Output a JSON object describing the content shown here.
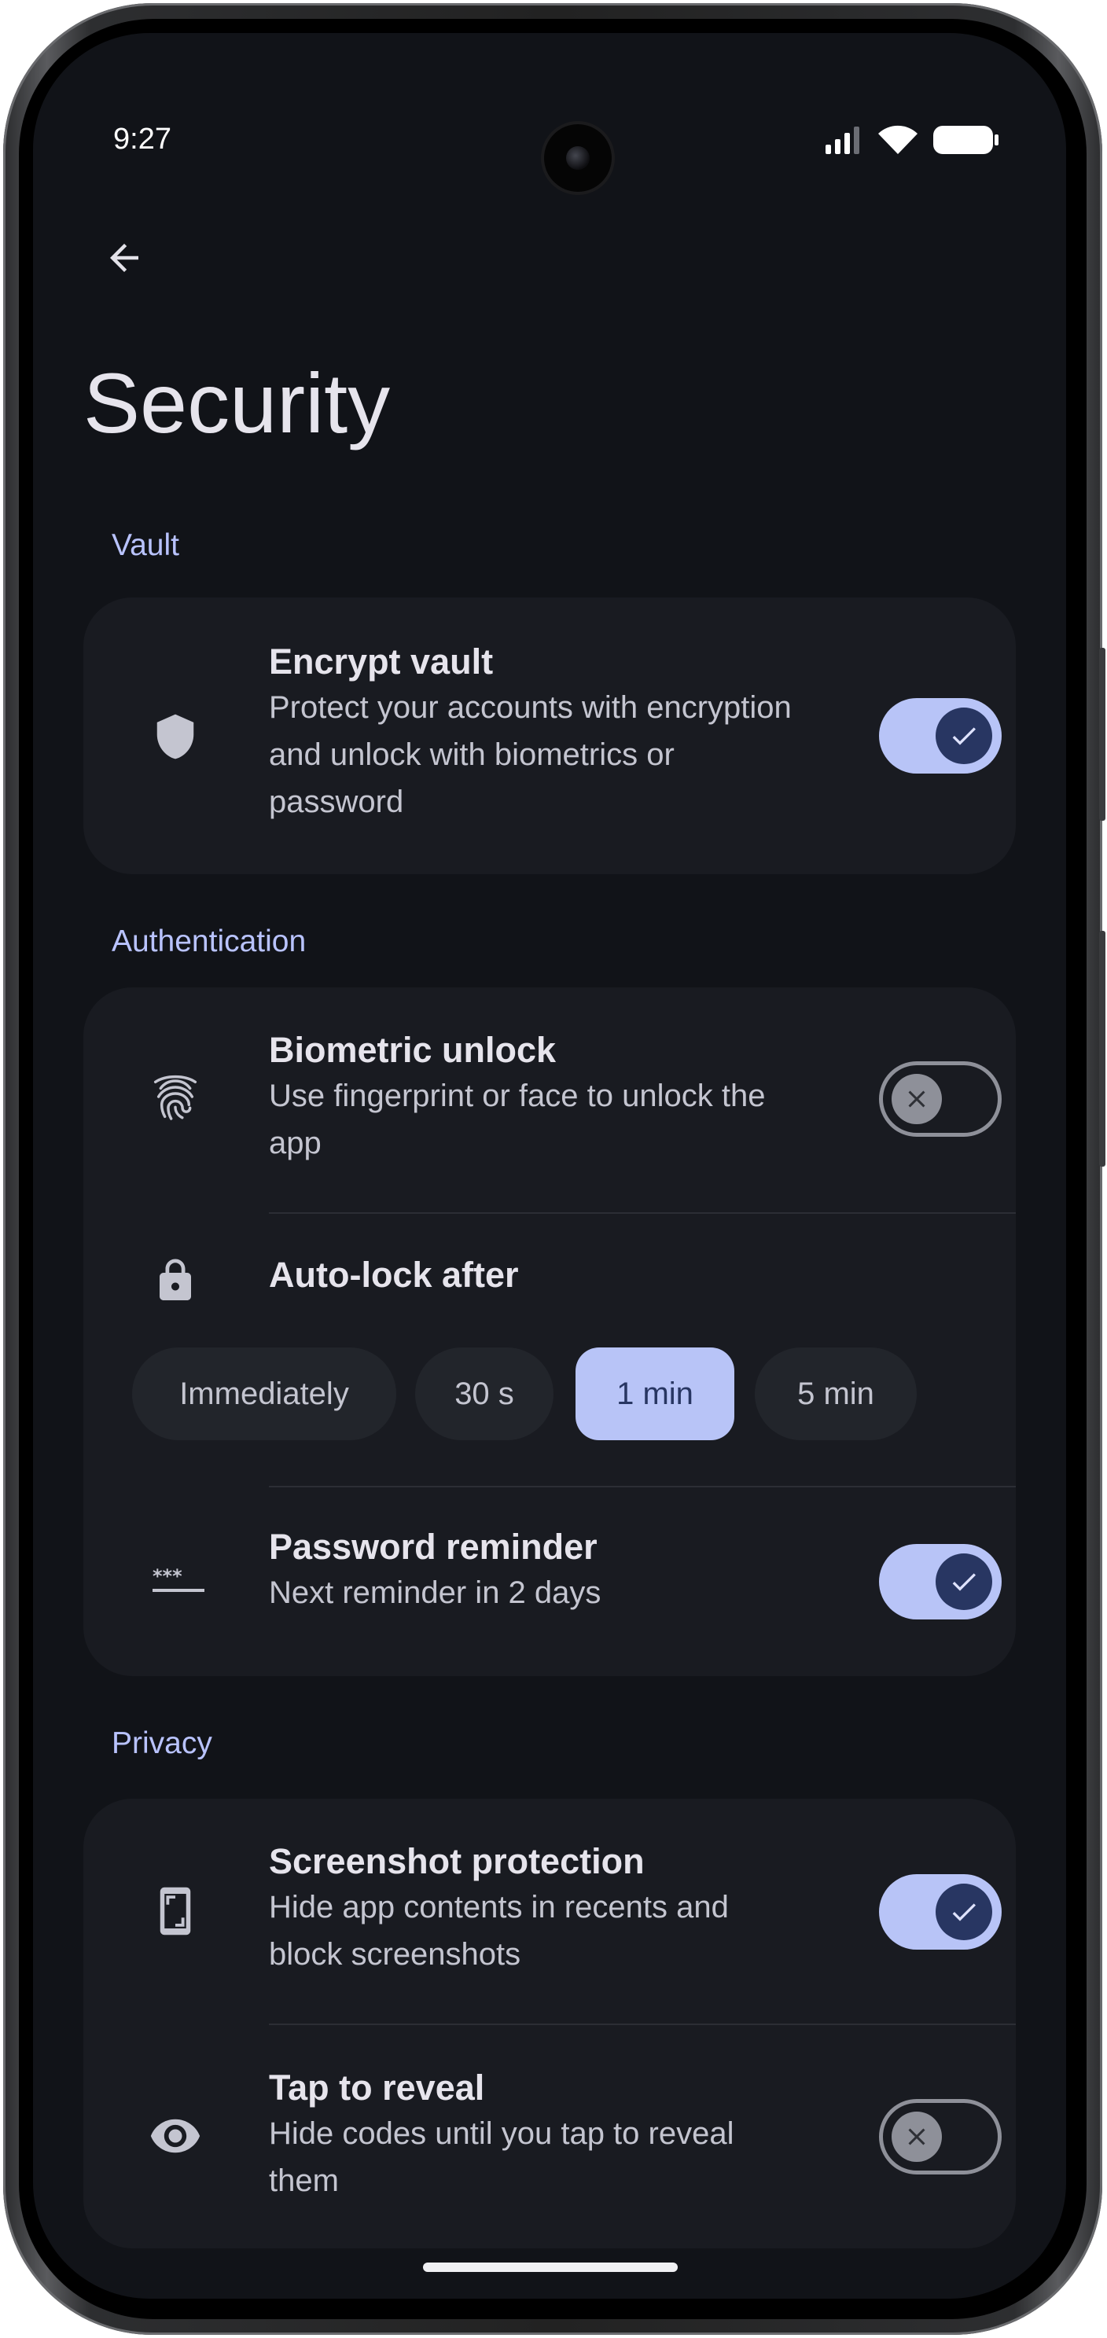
{
  "status_bar": {
    "time": "9:27"
  },
  "header": {
    "title": "Security"
  },
  "sections": [
    {
      "label": "Vault"
    },
    {
      "label": "Authentication"
    },
    {
      "label": "Privacy"
    }
  ],
  "vault": {
    "encrypt": {
      "title": "Encrypt vault",
      "subtitle_lines": [
        "Protect your accounts with encryption",
        "and unlock with biometrics or",
        "password"
      ],
      "toggle": "on",
      "icon": "shield-icon"
    }
  },
  "authentication": {
    "biometric": {
      "title": "Biometric unlock",
      "subtitle_lines": [
        "Use fingerprint or face to unlock the",
        "app"
      ],
      "toggle": "off",
      "icon": "fingerprint-icon"
    },
    "auto_lock": {
      "title": "Auto-lock after",
      "icon": "lock-icon",
      "options": [
        "Immediately",
        "30 s",
        "1 min",
        "5 min"
      ],
      "selected": "1 min"
    },
    "password_reminder": {
      "title": "Password reminder",
      "subtitle": "Next reminder in 2 days",
      "toggle": "on",
      "icon": "password-icon"
    }
  },
  "privacy": {
    "screenshot": {
      "title": "Screenshot protection",
      "subtitle_lines": [
        "Hide app contents in recents and",
        "block screenshots"
      ],
      "toggle": "on",
      "icon": "screenshot-icon"
    },
    "tap_reveal": {
      "title": "Tap to reveal",
      "subtitle_lines": [
        "Hide codes until you tap to reveal",
        "them"
      ],
      "toggle": "off",
      "icon": "eye-icon"
    }
  },
  "colors": {
    "background": "#111318",
    "card": "#191b21",
    "accent": "#b8c4f7",
    "accent_dark": "#283662",
    "section_label": "#b9c3ff"
  }
}
